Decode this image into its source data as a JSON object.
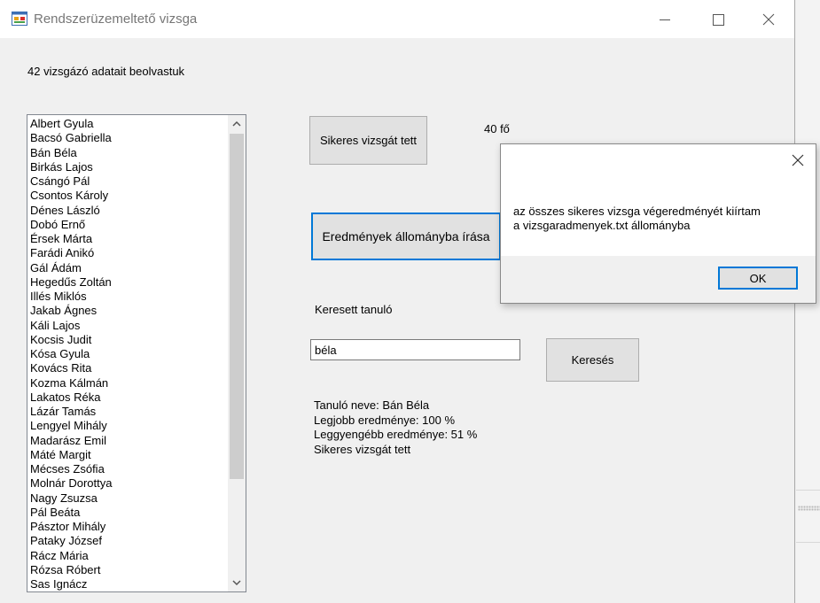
{
  "window": {
    "title": "Rendszerüzemeltető vizsga"
  },
  "labels": {
    "loaded": "42 vizsgázó adatait beolvastuk",
    "success_count": "40 fő",
    "searched_student": "Keresett tanuló"
  },
  "buttons": {
    "successful": "Sikeres vizsgát tett",
    "write_results": "Eredmények állományba írása",
    "search": "Keresés"
  },
  "search": {
    "value": "béla"
  },
  "result_lines": [
    "Tanuló neve: Bán Béla",
    "Legjobb eredménye: 100 %",
    "Leggyengébb eredménye: 51 %",
    "Sikeres vizsgát tett"
  ],
  "students": [
    "Albert Gyula",
    "Bacsó Gabriella",
    "Bán Béla",
    "Birkás Lajos",
    "Csángó Pál",
    "Csontos Károly",
    "Dénes László",
    "Dobó Ernő",
    "Érsek Márta",
    "Farádi Anikó",
    "Gál Ádám",
    "Hegedűs Zoltán",
    "Illés Miklós",
    "Jakab Ágnes",
    "Káli Lajos",
    "Kocsis Judit",
    "Kósa Gyula",
    "Kovács Rita",
    "Kozma Kálmán",
    "Lakatos Réka",
    "Lázár Tamás",
    "Lengyel Mihály",
    "Madarász Emil",
    "Máté Margit",
    "Mécses Zsófia",
    "Molnár Dorottya",
    "Nagy Zsuzsa",
    "Pál Beáta",
    "Pásztor Mihály",
    "Pataky József",
    "Rácz Mária",
    "Rózsa Róbert",
    "Sas Ignácz"
  ],
  "dialog": {
    "message_line1": "az összes sikeres vizsga végeredményét kiírtam",
    "message_line2": "a vizsgaradmenyek.txt állományba",
    "ok": "OK"
  },
  "icons": {
    "app": "app-form-icon",
    "minimize": "minimize-icon",
    "maximize": "maximize-icon",
    "close": "close-icon",
    "scroll_up": "chevron-up-icon",
    "scroll_down": "chevron-down-icon"
  },
  "colors": {
    "focus_border": "#0078d7",
    "button_face": "#e1e1e1"
  }
}
